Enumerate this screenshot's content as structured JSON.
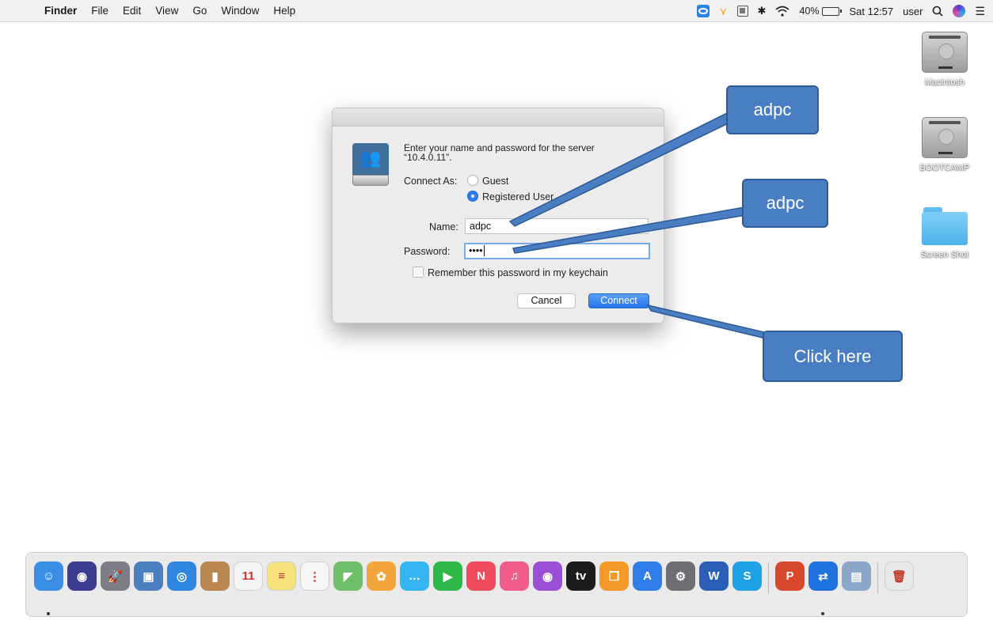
{
  "menubar": {
    "apple": "",
    "app_name": "Finder",
    "menus": [
      "File",
      "Edit",
      "View",
      "Go",
      "Window",
      "Help"
    ],
    "battery": "40%",
    "clock": "Sat 12:57",
    "user": "user",
    "search_glyph": "⚲",
    "list_glyph": "☰",
    "bluetooth_glyph": "✱"
  },
  "desktop": {
    "icons": [
      {
        "label": "Macintosh",
        "kind": "drive"
      },
      {
        "label": "BOOTCAMP",
        "kind": "drive"
      },
      {
        "label": "Screen Shot",
        "kind": "folder"
      }
    ]
  },
  "dialog": {
    "prompt": "Enter your name and password for the server “10.4.0.11”.",
    "connect_as_label": "Connect As:",
    "options": [
      "Guest",
      "Registered User"
    ],
    "selected_option": "Registered User",
    "name_label": "Name:",
    "name_value": "adpc",
    "password_label": "Password:",
    "password_mask": "••••",
    "remember_label": "Remember this password in my keychain",
    "remember_checked": false,
    "cancel_label": "Cancel",
    "connect_label": "Connect",
    "server_icon_glyph": "👥"
  },
  "annotations": [
    {
      "text": "adpc",
      "target": "name-field"
    },
    {
      "text": "adpc",
      "target": "password-field"
    },
    {
      "text": "Click here",
      "target": "connect-button"
    }
  ],
  "dock": {
    "apps": [
      {
        "name": "finder",
        "color": "#3a8ee6",
        "glyph": "☺"
      },
      {
        "name": "siri",
        "color": "#3b3b8f",
        "glyph": "◉"
      },
      {
        "name": "launchpad",
        "color": "#7d7d86",
        "glyph": "🚀"
      },
      {
        "name": "preview",
        "color": "#4b7fbf",
        "glyph": "▣"
      },
      {
        "name": "safari",
        "color": "#2f86e0",
        "glyph": "◎"
      },
      {
        "name": "contacts",
        "color": "#b9874f",
        "glyph": "▮"
      },
      {
        "name": "calendar",
        "color": "#f4f4f4",
        "glyph": "11"
      },
      {
        "name": "notes",
        "color": "#f6e27a",
        "glyph": "≡"
      },
      {
        "name": "reminders",
        "color": "#f6f6f6",
        "glyph": "⋮"
      },
      {
        "name": "maps",
        "color": "#6fbf6a",
        "glyph": "◤"
      },
      {
        "name": "photos",
        "color": "#f2a53a",
        "glyph": "✿"
      },
      {
        "name": "messages",
        "color": "#35b6f2",
        "glyph": "…"
      },
      {
        "name": "facetime",
        "color": "#2fb84a",
        "glyph": "▶"
      },
      {
        "name": "news",
        "color": "#f04a5e",
        "glyph": "N"
      },
      {
        "name": "music",
        "color": "#f15c8a",
        "glyph": "♫"
      },
      {
        "name": "podcasts",
        "color": "#9b4fd6",
        "glyph": "◉"
      },
      {
        "name": "tv",
        "color": "#1c1c1c",
        "glyph": "tv"
      },
      {
        "name": "books",
        "color": "#f59a28",
        "glyph": "❐"
      },
      {
        "name": "app-store",
        "color": "#2f7de8",
        "glyph": "A"
      },
      {
        "name": "system-preferences",
        "color": "#6d6d73",
        "glyph": "⚙"
      },
      {
        "name": "word",
        "color": "#2b5fb7",
        "glyph": "W"
      },
      {
        "name": "skype",
        "color": "#1fa1e8",
        "glyph": "S"
      },
      {
        "name": "powerpoint",
        "color": "#d8482c",
        "glyph": "P"
      },
      {
        "name": "teamviewer",
        "color": "#1f73e0",
        "glyph": "⇄"
      },
      {
        "name": "preview-2",
        "color": "#8aa7c9",
        "glyph": "▤"
      },
      {
        "name": "trash",
        "color": "#e8e8e8",
        "glyph": "🗑"
      }
    ],
    "running": [
      "finder",
      "teamviewer"
    ]
  }
}
